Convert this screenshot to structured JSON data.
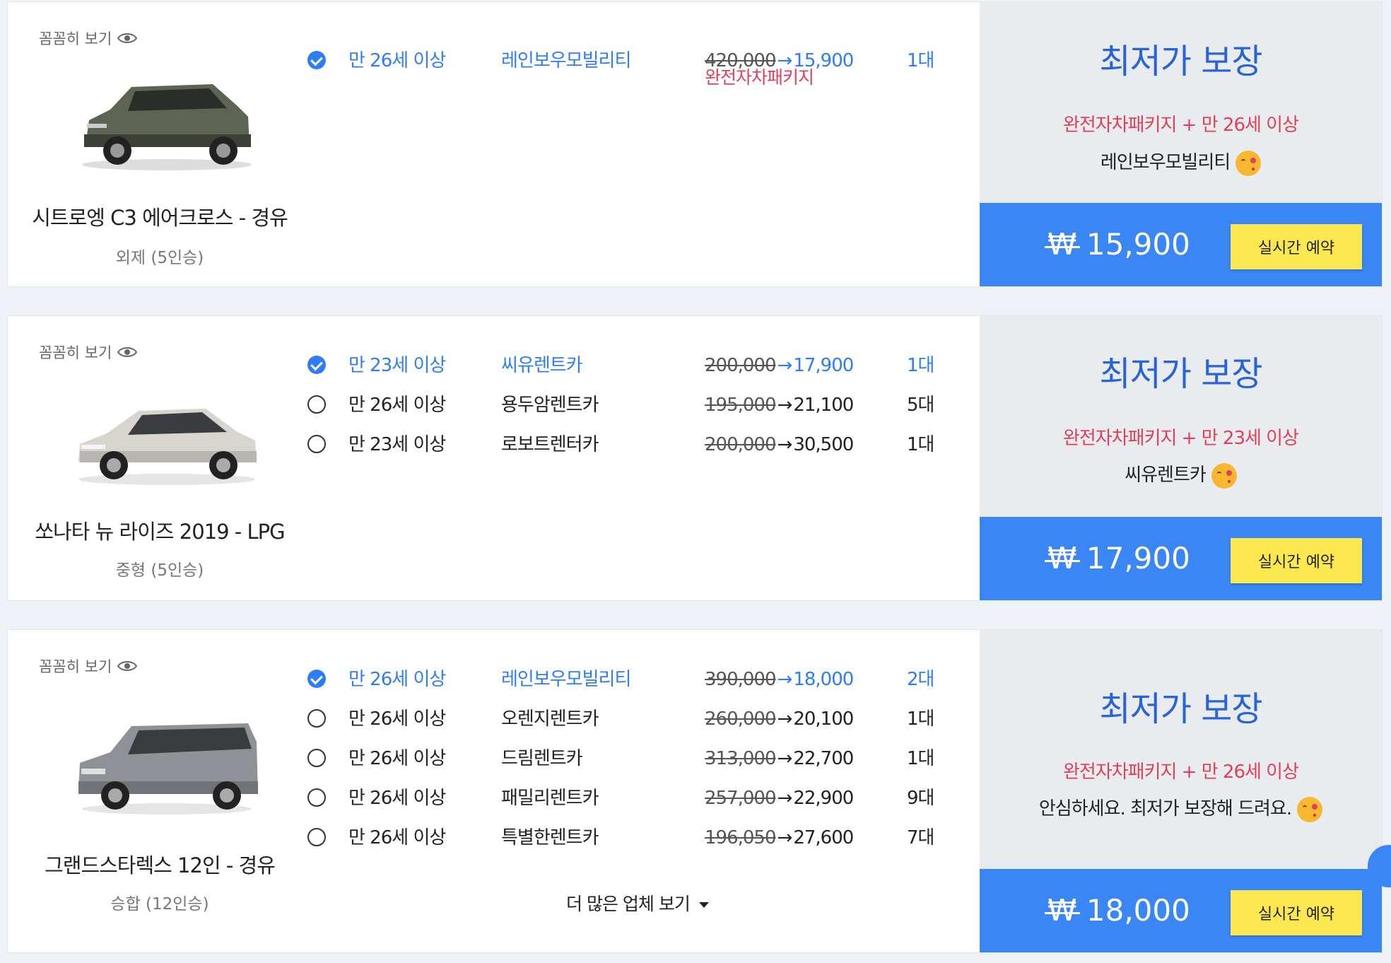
{
  "common": {
    "detail_link": "꼼꼼히 보기",
    "best_title": "최저가 보장",
    "reserve_label": "실시간 예약",
    "won_symbol": "₩",
    "arrow": "→",
    "more_label": "더 많은 업체 보기"
  },
  "listings": [
    {
      "car_name": "시트로엥 C3 에어크로스 - 경유",
      "car_class": "외제 (5인승)",
      "package_label": "완전자차패키지",
      "offers": [
        {
          "selected": true,
          "age": "만 26세 이상",
          "company": "레인보우모빌리티",
          "old_price": "420,000",
          "new_price": "15,900",
          "count": "1대"
        }
      ],
      "best_condition": "완전자차패키지 + 만 26세 이상",
      "best_company": "레인보우모빌리티",
      "price": "15,900"
    },
    {
      "car_name": "쏘나타 뉴 라이즈 2019 - LPG",
      "car_class": "중형 (5인승)",
      "offers": [
        {
          "selected": true,
          "age": "만 23세 이상",
          "company": "씨유렌트카",
          "old_price": "200,000",
          "new_price": "17,900",
          "count": "1대"
        },
        {
          "selected": false,
          "age": "만 26세 이상",
          "company": "용두암렌트카",
          "old_price": "195,000",
          "new_price": "21,100",
          "count": "5대"
        },
        {
          "selected": false,
          "age": "만 23세 이상",
          "company": "로보트렌터카",
          "old_price": "200,000",
          "new_price": "30,500",
          "count": "1대"
        }
      ],
      "best_condition": "완전자차패키지 + 만 23세 이상",
      "best_company": "씨유렌트카",
      "price": "17,900"
    },
    {
      "car_name": "그랜드스타렉스 12인 - 경유",
      "car_class": "승합 (12인승)",
      "offers": [
        {
          "selected": true,
          "age": "만 26세 이상",
          "company": "레인보우모빌리티",
          "old_price": "390,000",
          "new_price": "18,000",
          "count": "2대"
        },
        {
          "selected": false,
          "age": "만 26세 이상",
          "company": "오렌지렌트카",
          "old_price": "260,000",
          "new_price": "20,100",
          "count": "1대"
        },
        {
          "selected": false,
          "age": "만 26세 이상",
          "company": "드림렌트카",
          "old_price": "313,000",
          "new_price": "22,700",
          "count": "1대"
        },
        {
          "selected": false,
          "age": "만 26세 이상",
          "company": "패밀리렌트카",
          "old_price": "257,000",
          "new_price": "22,900",
          "count": "9대"
        },
        {
          "selected": false,
          "age": "만 26세 이상",
          "company": "특별한렌트카",
          "old_price": "196,050",
          "new_price": "27,600",
          "count": "7대"
        }
      ],
      "best_condition": "완전자차패키지 + 만 26세 이상",
      "best_company": "안심하세요. 최저가 보장해 드려요.",
      "price": "18,000"
    }
  ],
  "colors": {
    "accent_blue": "#2f7df6",
    "price_bar": "#3a86f5",
    "title_blue": "#2a62d8",
    "highlight_red": "#e0405a",
    "reserve_yellow": "#fbe851"
  }
}
